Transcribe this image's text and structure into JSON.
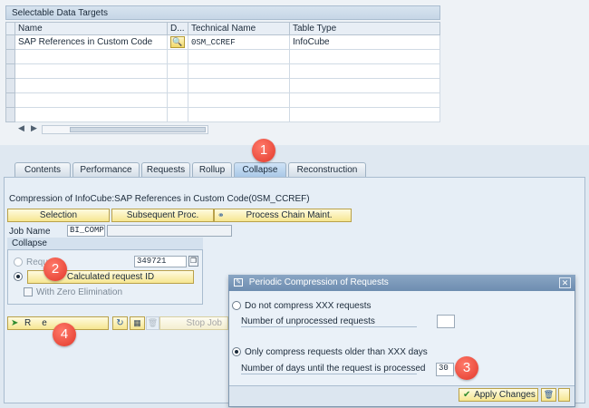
{
  "data_targets": {
    "title": "Selectable Data Targets",
    "columns": [
      "Name",
      "D...",
      "Technical Name",
      "Table Type"
    ],
    "rows": [
      {
        "name": "SAP References in Custom Code",
        "technical_name": "0SM_CCREF",
        "table_type": "InfoCube"
      }
    ]
  },
  "tabs": [
    {
      "label": "Contents"
    },
    {
      "label": "Performance"
    },
    {
      "label": "Requests"
    },
    {
      "label": "Rollup"
    },
    {
      "label": "Collapse"
    },
    {
      "label": "Reconstruction"
    }
  ],
  "collapse_panel": {
    "heading": "Compression of InfoCube:SAP References in Custom Code(0SM_CCREF)",
    "selection_button": "Selection",
    "subsequent_button": "Subsequent Proc.",
    "process_chain_button": "Process Chain Maint.",
    "job_name_label": "Job Name",
    "job_name_value": "BI_COMP",
    "group_title": "Collapse",
    "request_label": "Reque",
    "request_value": "349721",
    "calc_request_button": "Calculated request ID",
    "zero_elim_label": "With Zero Elimination",
    "release_button": "R",
    "release_button_tail": "e",
    "stop_job_button": "Stop Job"
  },
  "dialog": {
    "title": "Periodic Compression of Requests",
    "option1_label": "Do not compress XXX requests",
    "option1_field_label": "Number of unprocessed requests",
    "option1_field_value": "",
    "option2_label": "Only compress requests older than XXX days",
    "option2_field_label": "Number of days until the request is processed",
    "option2_field_value": "30",
    "apply_button": "Apply Changes"
  },
  "badges": [
    "1",
    "2",
    "3",
    "4"
  ],
  "colors": {
    "badge": "#e2382a",
    "yellow_button": "#f6e690",
    "dialog_title": "#6e8db0"
  }
}
